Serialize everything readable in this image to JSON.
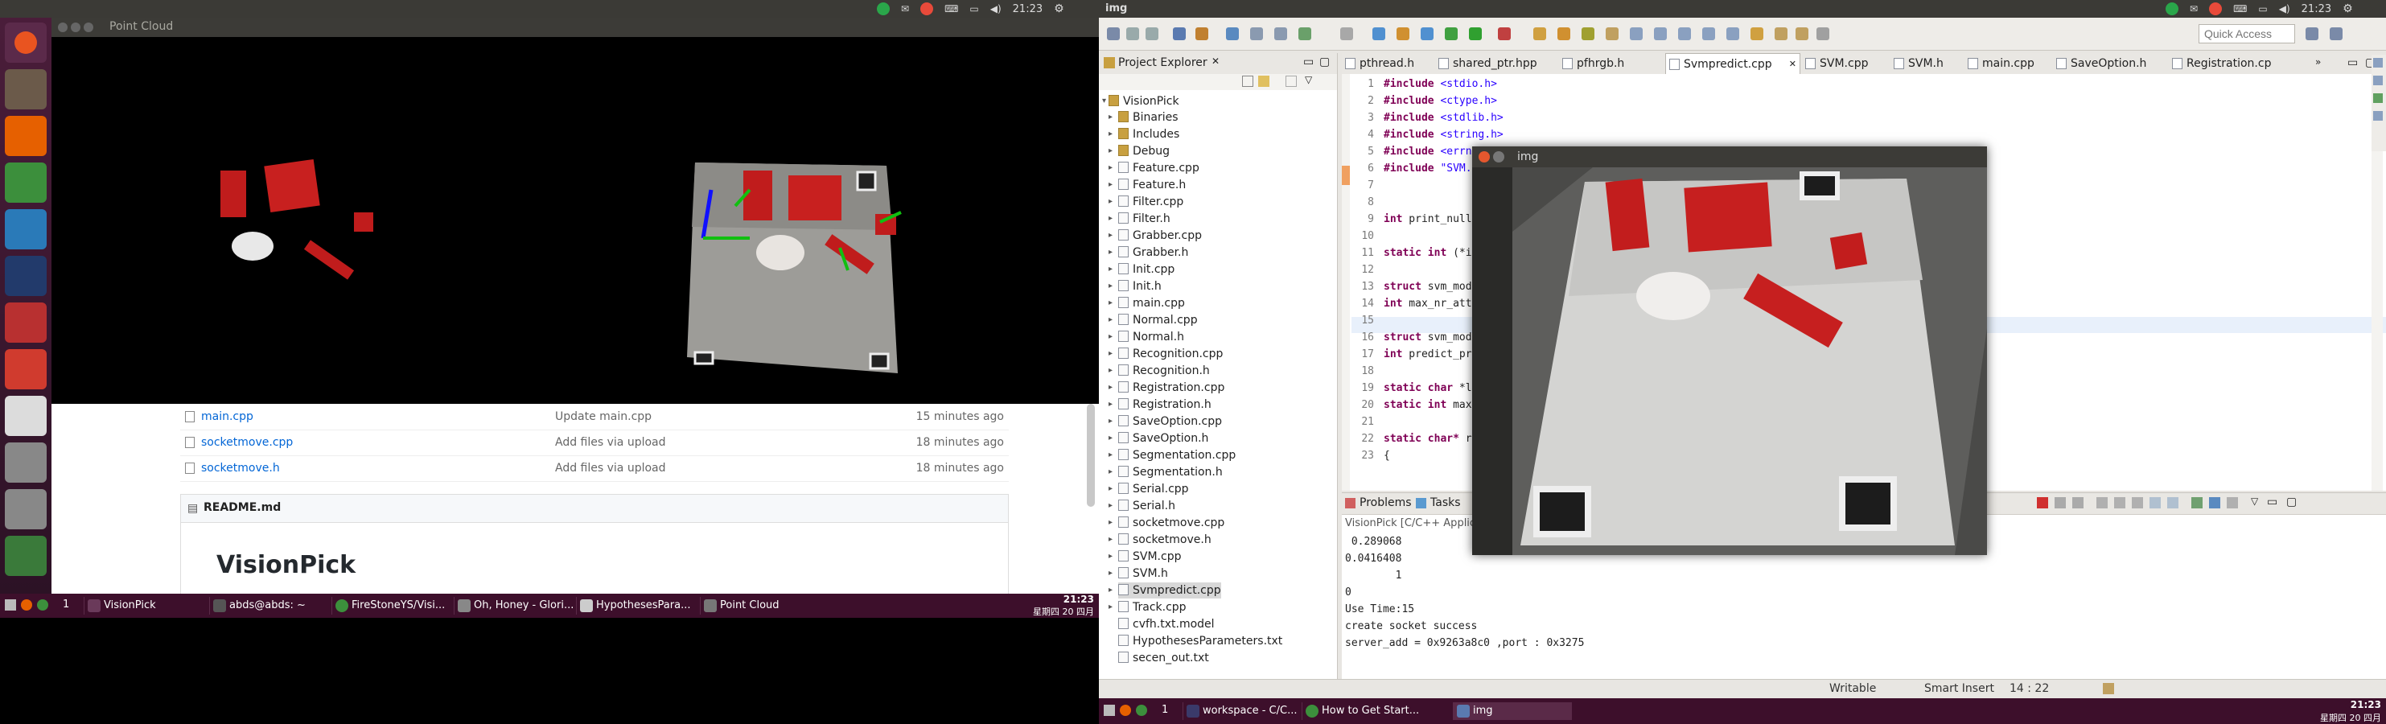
{
  "left_screen": {
    "topbar": {
      "title": "",
      "time": "21:23"
    },
    "point_cloud_window": {
      "title": "Point Cloud"
    },
    "github": {
      "files": [
        {
          "name": "main.cpp",
          "message": "Update main.cpp",
          "age": "15 minutes ago"
        },
        {
          "name": "socketmove.cpp",
          "message": "Add files via upload",
          "age": "18 minutes ago"
        },
        {
          "name": "socketmove.h",
          "message": "Add files via upload",
          "age": "18 minutes ago"
        }
      ],
      "readme_label": "README.md",
      "readme_heading": "VisionPick"
    },
    "taskbar": {
      "workspace": "1",
      "tasks": [
        "VisionPick",
        "abds@abds: ~",
        "FireStoneYS/Visi...",
        "Oh, Honey - Glori...",
        "HypothesesPara...",
        "Point Cloud"
      ],
      "clock_time": "21:23",
      "clock_date": "星期四 20 四月"
    }
  },
  "right_screen": {
    "topbar": {
      "title": "img",
      "time": "21:23"
    },
    "quick_access_placeholder": "Quick Access",
    "project_explorer": {
      "title": "Project Explorer",
      "project": "VisionPick",
      "items": [
        "Binaries",
        "Includes",
        "Debug",
        "Feature.cpp",
        "Feature.h",
        "Filter.cpp",
        "Filter.h",
        "Grabber.cpp",
        "Grabber.h",
        "Init.cpp",
        "Init.h",
        "main.cpp",
        "Normal.cpp",
        "Normal.h",
        "Recognition.cpp",
        "Recognition.h",
        "Registration.cpp",
        "Registration.h",
        "SaveOption.cpp",
        "SaveOption.h",
        "Segmentation.cpp",
        "Segmentation.h",
        "Serial.cpp",
        "Serial.h",
        "socketmove.cpp",
        "socketmove.h",
        "SVM.cpp",
        "SVM.h",
        "Svmpredict.cpp",
        "Track.cpp",
        "cvfh.txt.model",
        "HypothesesParameters.txt",
        "secen_out.txt"
      ]
    },
    "editor_tabs": [
      "pthread.h",
      "shared_ptr.hpp",
      "pfhrgb.h",
      "Svmpredict.cpp",
      "SVM.cpp",
      "SVM.h",
      "main.cpp",
      "SaveOption.h",
      "Registration.cp"
    ],
    "active_tab": "Svmpredict.cpp",
    "code_lines": [
      {
        "n": "1",
        "kw": "#include",
        "rest": " <stdio.h>"
      },
      {
        "n": "2",
        "kw": "#include",
        "rest": " <ctype.h>"
      },
      {
        "n": "3",
        "kw": "#include",
        "rest": " <stdlib.h>"
      },
      {
        "n": "4",
        "kw": "#include",
        "rest": " <string.h>"
      },
      {
        "n": "5",
        "kw": "#include",
        "rest": " <errno"
      },
      {
        "n": "6",
        "kw": "#include",
        "rest": " \"SVM.h"
      },
      {
        "n": "7",
        "kw": "",
        "rest": ""
      },
      {
        "n": "8",
        "kw": "",
        "rest": ""
      },
      {
        "n": "9",
        "kw": "int",
        "rest": " print_null"
      },
      {
        "n": "10",
        "kw": "",
        "rest": ""
      },
      {
        "n": "11",
        "kw": "static int",
        "rest": " (*in"
      },
      {
        "n": "12",
        "kw": "",
        "rest": ""
      },
      {
        "n": "13",
        "kw": "struct",
        "rest": " svm_mode"
      },
      {
        "n": "14",
        "kw": "int",
        "rest": " max_nr_att"
      },
      {
        "n": "15",
        "kw": "",
        "rest": ""
      },
      {
        "n": "16",
        "kw": "struct",
        "rest": " svm_mode"
      },
      {
        "n": "17",
        "kw": "int",
        "rest": " predict_pr"
      },
      {
        "n": "18",
        "kw": "",
        "rest": ""
      },
      {
        "n": "19",
        "kw": "static char",
        "rest": " *l"
      },
      {
        "n": "20",
        "kw": "static int",
        "rest": " max"
      },
      {
        "n": "21",
        "kw": "",
        "rest": ""
      },
      {
        "n": "22",
        "kw": "static char*",
        "rest": " re"
      },
      {
        "n": "23",
        "kw": "",
        "rest": "{"
      }
    ],
    "console": {
      "tabs": [
        "Problems",
        "Tasks"
      ],
      "app_label": "VisionPick [C/C++ Applic",
      "lines": [
        " 0.289068",
        "0.0416408",
        "        1",
        "0",
        "Use Time:15",
        "create socket success",
        "server_add = 0x9263a8c0 ,port : 0x3275"
      ]
    },
    "status": {
      "mode": "Writable",
      "insert": "Smart Insert",
      "position": "14 : 22"
    },
    "img_window": {
      "title": "img"
    },
    "taskbar": {
      "workspace": "1",
      "tasks": [
        "workspace - C/C...",
        "How to Get Start...",
        "img"
      ],
      "clock_time": "21:23",
      "clock_date": "星期四 20 四月"
    }
  }
}
